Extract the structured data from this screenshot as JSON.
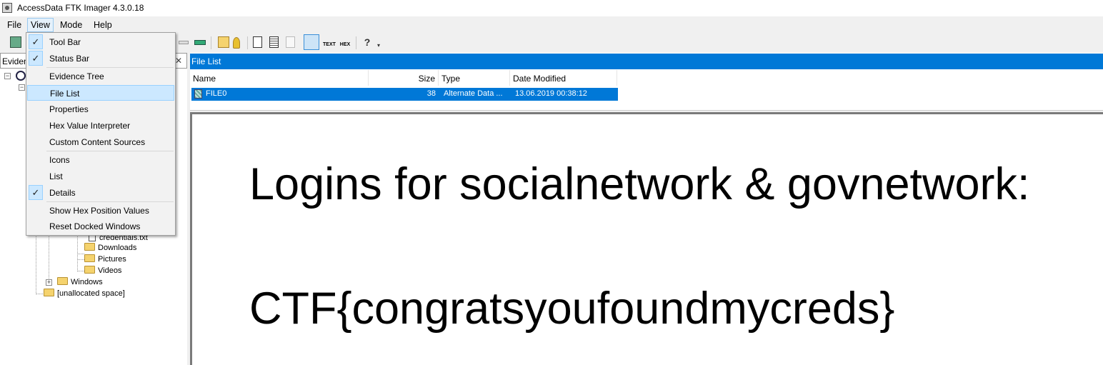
{
  "window": {
    "title": "AccessData FTK Imager 4.3.0.18"
  },
  "menubar": {
    "items": [
      "File",
      "View",
      "Mode",
      "Help"
    ]
  },
  "view_menu": {
    "items": [
      {
        "label": "Tool Bar",
        "checked": true
      },
      {
        "label": "Status Bar",
        "checked": true
      },
      {
        "label": "Evidence Tree",
        "checked": false
      },
      {
        "label": "File List",
        "checked": false,
        "highlighted": true
      },
      {
        "label": "Properties",
        "checked": false
      },
      {
        "label": "Hex Value Interpreter",
        "checked": false
      },
      {
        "label": "Custom Content Sources",
        "checked": false
      },
      {
        "label": "Icons",
        "checked": false
      },
      {
        "label": "List",
        "checked": false
      },
      {
        "label": "Details",
        "checked": true
      },
      {
        "label": "Show Hex Position Values",
        "checked": false
      },
      {
        "label": "Reset Docked Windows",
        "checked": false
      }
    ]
  },
  "evidence_tree": {
    "header": "Eviden",
    "close": "✕",
    "nodes": {
      "credentials": "credentials.txt",
      "downloads": "Downloads",
      "pictures": "Pictures",
      "videos": "Videos",
      "windows": "Windows",
      "unallocated": "[unallocated space]"
    }
  },
  "file_list": {
    "header": "File List",
    "columns": [
      "Name",
      "Size",
      "Type",
      "Date Modified"
    ],
    "rows": [
      {
        "name": "FILE0",
        "size": "38",
        "type": "Alternate Data ...",
        "date_modified": "13.06.2019 00:38:12"
      }
    ]
  },
  "viewer": {
    "line1": "Logins for socialnetwork & govnetwork:",
    "line2": "CTF{congratsyoufoundmycreds}"
  },
  "colors": {
    "selection": "#0078d7",
    "menu_highlight": "#cce8ff",
    "chrome": "#f0f0f0"
  }
}
